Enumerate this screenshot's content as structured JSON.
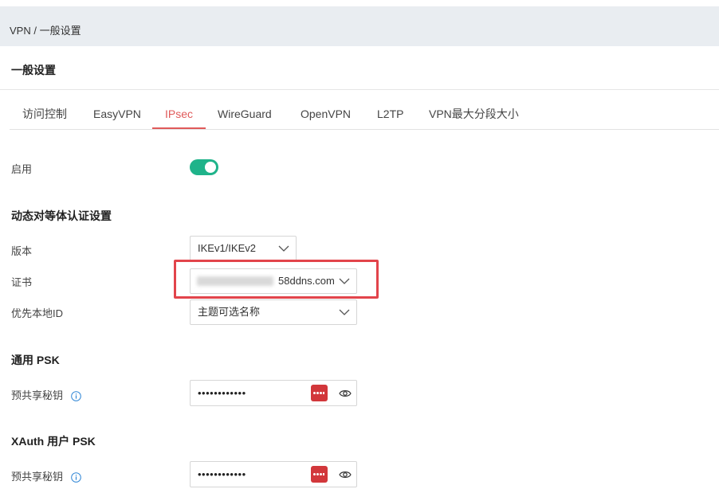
{
  "breadcrumb": "VPN / 一般设置",
  "page_title": "一般设置",
  "tabs": [
    {
      "label": "访问控制"
    },
    {
      "label": "EasyVPN"
    },
    {
      "label": "IPsec"
    },
    {
      "label": "WireGuard"
    },
    {
      "label": "OpenVPN"
    },
    {
      "label": "L2TP"
    },
    {
      "label": "VPN最大分段大小"
    }
  ],
  "active_tab": "IPsec",
  "enable": {
    "label": "启用",
    "value": "on"
  },
  "dynamic_peer": {
    "heading": "动态对等体认证设置",
    "version": {
      "label": "版本",
      "value": "IKEv1/IKEv2"
    },
    "certificate": {
      "label": "证书",
      "value": "58ddns.com"
    },
    "local_id": {
      "label": "优先本地ID",
      "value": "主题可选名称"
    }
  },
  "general_psk": {
    "heading": "通用 PSK",
    "label": "预共享秘钥",
    "value": "••••••••••••"
  },
  "xauth_psk": {
    "heading": "XAuth 用户 PSK",
    "label": "预共享秘钥",
    "value": "••••••••••••"
  },
  "colors": {
    "accent_red": "#e05a5a",
    "toggle_green": "#1fb38a",
    "highlight_red": "#e2444b",
    "password_manager_red": "#d2373b",
    "info_blue": "#2f86d6"
  }
}
